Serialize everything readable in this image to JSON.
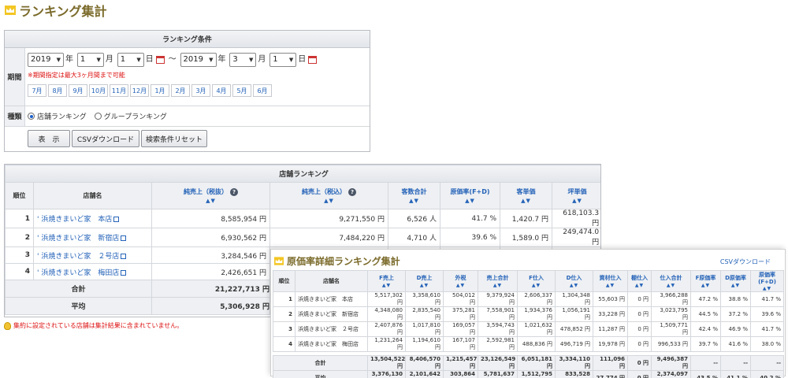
{
  "page_title": "ランキング集計",
  "conditions": {
    "header": "ランキング条件",
    "period_label": "期間",
    "from": {
      "year": "2019",
      "year_unit": "年",
      "month": "1",
      "month_unit": "月",
      "day": "1",
      "day_unit": "日"
    },
    "tilde": "～",
    "to": {
      "year": "2019",
      "year_unit": "年",
      "month": "3",
      "month_unit": "月",
      "day": "1",
      "day_unit": "日"
    },
    "note": "※期間指定は最大3ヶ月間まで可能",
    "months": [
      "7月",
      "8月",
      "9月",
      "10月",
      "11月",
      "12月",
      "1月",
      "2月",
      "3月",
      "4月",
      "5月",
      "6月"
    ],
    "type_label": "種類",
    "radio_store": "店舗ランキング",
    "radio_group": "グループランキング",
    "btn_display": "表　示",
    "btn_csv": "CSVダウンロード",
    "btn_reset": "検索条件リセット"
  },
  "store_ranking": {
    "caption": "店舗ランキング",
    "arrows": "▲▼",
    "help": "?",
    "headers": [
      "順位",
      "店舗名",
      "純売上（税抜）",
      "純売上（税込）",
      "客数合計",
      "原価率(F+D)",
      "客単価",
      "坪単価"
    ],
    "rows": [
      {
        "rank": "1",
        "name": "' 浜焼きまいど家　本店",
        "net_ex": "8,585,954 円",
        "net_in": "9,271,550 円",
        "customers": "6,526 人",
        "cost_rate": "41.7 %",
        "per_customer": "1,420.7 円",
        "per_tsubo": "618,103.3 円"
      },
      {
        "rank": "2",
        "name": "' 浜焼きまいど家　新宿店",
        "net_ex": "6,930,562 円",
        "net_in": "7,484,220 円",
        "customers": "4,710 人",
        "cost_rate": "39.6 %",
        "per_customer": "1,589.0 円",
        "per_tsubo": "249,474.0 円"
      },
      {
        "rank": "3",
        "name": "' 浜焼きまいど家　２号店",
        "net_ex": "3,284,546 円"
      },
      {
        "rank": "4",
        "name": "' 浜焼きまいど家　梅田店",
        "net_ex": "2,426,651 円"
      }
    ],
    "total_label": "合計",
    "total_value": "21,227,713 円",
    "avg_label": "平均",
    "avg_value": "5,306,928 円"
  },
  "warning": "集約に設定されている店舗は集計結果に含まれていません。",
  "cost_ranking": {
    "title": "原価率詳細ランキング集計",
    "csv_link": "CSVダウンロード",
    "headers": [
      "順位",
      "店舗名",
      "F売上",
      "D売上",
      "外税",
      "売上合計",
      "F仕入",
      "D仕入",
      "資材仕入",
      "棚仕入",
      "仕入合計",
      "F原価率",
      "D原価率",
      "原価率(F+D)"
    ],
    "rows": [
      [
        "1",
        "浜焼きまいど家　本店",
        "5,517,302 円",
        "3,358,610 円",
        "504,012 円",
        "9,379,924 円",
        "2,606,337 円",
        "1,304,348 円",
        "55,603 円",
        "0 円",
        "3,966,288 円",
        "47.2 %",
        "38.8 %",
        "41.7 %"
      ],
      [
        "2",
        "浜焼きまいど家　新宿店",
        "4,348,080 円",
        "2,835,540 円",
        "375,281 円",
        "7,558,901 円",
        "1,934,376 円",
        "1,056,191 円",
        "33,228 円",
        "0 円",
        "3,023,795 円",
        "44.5 %",
        "37.2 %",
        "39.6 %"
      ],
      [
        "3",
        "浜焼きまいど家　２号店",
        "2,407,876 円",
        "1,017,810 円",
        "169,057 円",
        "3,594,743 円",
        "1,021,632 円",
        "478,852 円",
        "11,287 円",
        "0 円",
        "1,509,771 円",
        "42.4 %",
        "46.9 %",
        "41.7 %"
      ],
      [
        "4",
        "浜焼きまいど家　梅田店",
        "1,231,264 円",
        "1,194,610 円",
        "167,107 円",
        "2,592,981 円",
        "488,836 円",
        "496,719 円",
        "19,978 円",
        "0 円",
        "996,533 円",
        "39.7 %",
        "41.6 %",
        "38.0 %"
      ]
    ],
    "total": [
      "合計",
      "13,504,522 円",
      "8,406,570 円",
      "1,215,457 円",
      "23,126,549 円",
      "6,051,181 円",
      "3,334,110 円",
      "111,096 円",
      "0 円",
      "9,496,387 円",
      "--",
      "--",
      "--"
    ],
    "avg": [
      "平均",
      "3,376,130 円",
      "2,101,642 円",
      "303,864 円",
      "5,781,637 円",
      "1,512,795 円",
      "833,528 円",
      "27,774 円",
      "0 円",
      "2,374,097 円",
      "43.5 %",
      "41.1 %",
      "40.2 %"
    ]
  }
}
